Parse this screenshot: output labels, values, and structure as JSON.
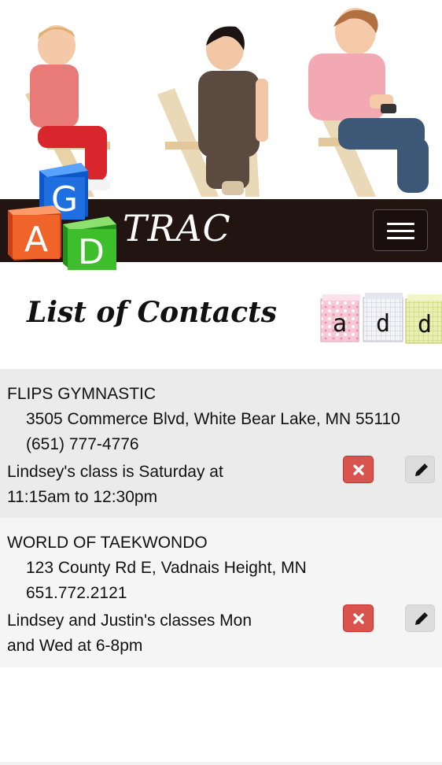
{
  "header": {
    "brand_suffix": "TRAC",
    "logo_letters": [
      "G",
      "A",
      "D"
    ],
    "menu_icon": "hamburger-icon",
    "colors": {
      "navbar": "#221410",
      "block_blue": "#1f6fe0",
      "block_red": "#f0642a",
      "block_green": "#3cbf2a"
    }
  },
  "page": {
    "heading": "List of Contacts",
    "add_blocks": [
      "a",
      "d",
      "d"
    ]
  },
  "contacts": [
    {
      "name": "FLIPS GYMNASTIC",
      "address": "3505 Commerce Blvd, White Bear Lake, MN 55110",
      "phone": "(651) 777-4776",
      "note": "Lindsey's class is Saturday at 11:15am to 12:30pm",
      "delete_icon": "close-icon",
      "edit_icon": "pencil-icon"
    },
    {
      "name": "WORLD OF TAEKWONDO",
      "address": "123 County Rd E, Vadnais Height, MN",
      "phone": "651.772.2121",
      "note": "Lindsey and Justin's classes Mon and Wed at 6-8pm",
      "delete_icon": "close-icon",
      "edit_icon": "pencil-icon"
    }
  ],
  "colors": {
    "delete_button": "#d9534f",
    "edit_button": "#dcdcdc",
    "row_odd": "#ebebeb",
    "row_even": "#f5f5f5"
  }
}
